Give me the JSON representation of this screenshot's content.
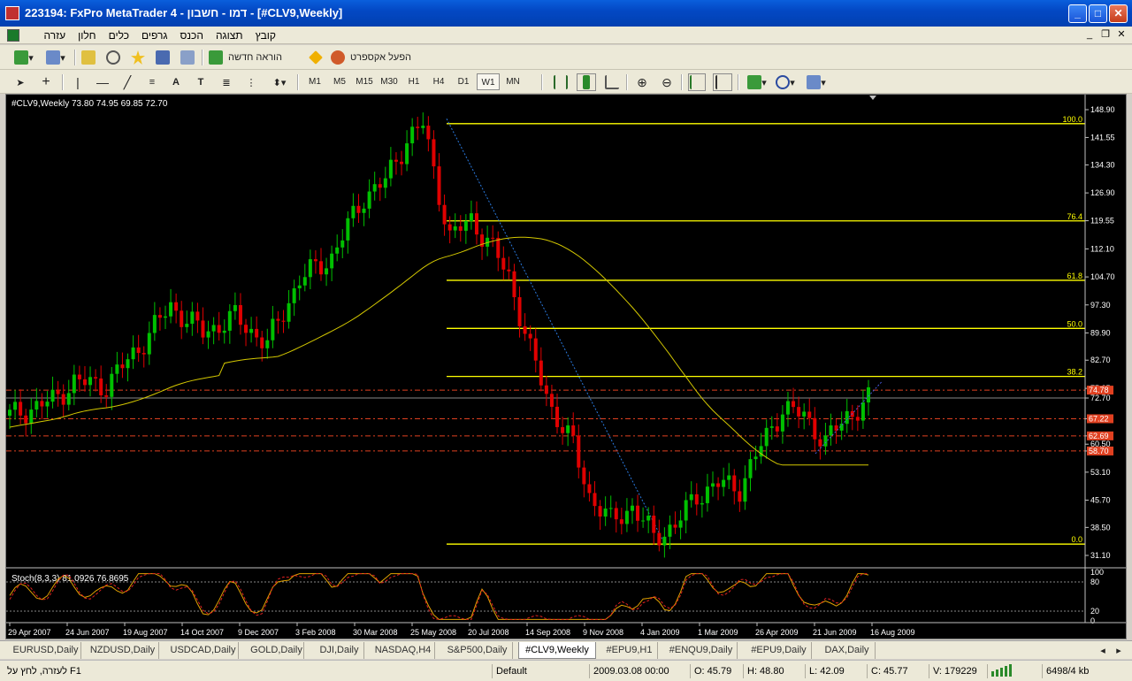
{
  "window": {
    "title": "223194: FxPro MetaTrader 4 - דמו - חשבון - [#CLV9,Weekly]"
  },
  "menu": {
    "items": [
      "קובץ",
      "תצוגה",
      "הכנס",
      "גרפים",
      "כלים",
      "חלון",
      "עזרה"
    ]
  },
  "toolbar": {
    "new_order_label": "הוראה חדשה",
    "expert_label": "הפעל אקספרט"
  },
  "timeframes": [
    "M1",
    "M5",
    "M15",
    "M30",
    "H1",
    "H4",
    "D1",
    "W1",
    "MN"
  ],
  "active_timeframe": "W1",
  "chart": {
    "header": "#CLV9,Weekly  73.80 74.95 69.85 72.70",
    "stoch_label": "Stoch(8,3,3) 81.0926 76.8695",
    "price_ticks": [
      "148.90",
      "141.55",
      "134.30",
      "126.90",
      "119.55",
      "112.10",
      "104.70",
      "97.30",
      "89.90",
      "82.70",
      "75.25",
      "72.70",
      "67.22",
      "62.69",
      "60.50",
      "58.70",
      "53.10",
      "45.70",
      "38.50",
      "31.10"
    ],
    "fib_labels": [
      "100.0",
      "76.4",
      "61.8",
      "50.0",
      "38.2",
      "0.0"
    ],
    "stoch_ticks": [
      "100",
      "80",
      "20",
      "0"
    ],
    "date_ticks": [
      "29 Apr 2007",
      "24 Jun 2007",
      "19 Aug 2007",
      "14 Oct 2007",
      "9 Dec 2007",
      "3 Feb 2008",
      "30 Mar 2008",
      "25 May 2008",
      "20 Jul 2008",
      "14 Sep 2008",
      "9 Nov 2008",
      "4 Jan 2009",
      "1 Mar 2009",
      "26 Apr 2009",
      "21 Jun 2009",
      "16 Aug 2009"
    ],
    "level_labels": [
      "74.78",
      "67.22",
      "62.69",
      "58.70"
    ],
    "colors": {
      "up": "#00c000",
      "down": "#e00000",
      "fib": "#ffff00",
      "ma": "#d4c800",
      "level": "#e04020"
    }
  },
  "tabs": [
    "EURUSD,Daily",
    "NZDUSD,Daily",
    "USDCAD,Daily",
    "GOLD,Daily",
    "DJI,Daily",
    "NASDAQ,H4",
    "S&P500,Daily",
    "#CLV9,Weekly",
    "#EPU9,H1",
    "#ENQU9,Daily",
    "#EPU9,Daily",
    "DAX,Daily"
  ],
  "active_tab": "#CLV9,Weekly",
  "status": {
    "help": "לעזרה, לחץ על F1",
    "profile": "Default",
    "datetime": "2009.03.08 00:00",
    "open": "O: 45.79",
    "high": "H: 48.80",
    "low": "L: 42.09",
    "close": "C: 45.77",
    "volume": "V: 179229",
    "traffic": "6498/4 kb"
  }
}
